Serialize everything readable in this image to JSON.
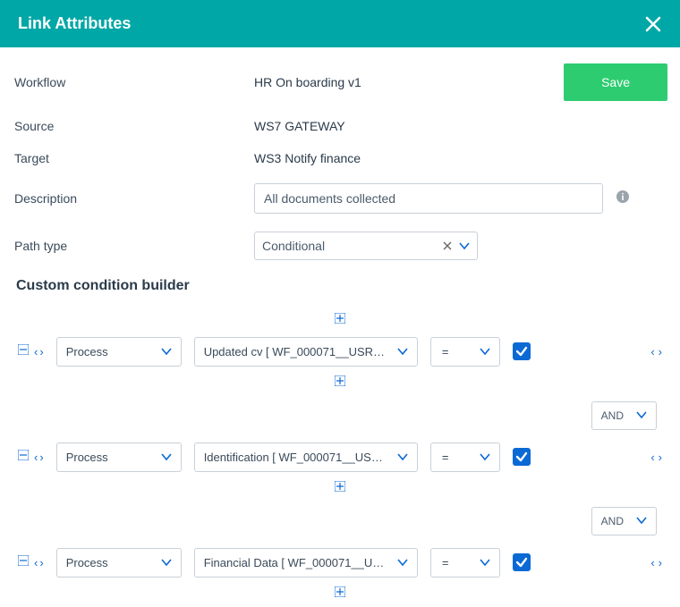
{
  "header": {
    "title": "Link Attributes"
  },
  "labels": {
    "workflow": "Workflow",
    "source": "Source",
    "target": "Target",
    "description": "Description",
    "path_type": "Path type",
    "save": "Save"
  },
  "values": {
    "workflow": "HR On boarding v1",
    "source": "WS7 GATEWAY",
    "target": "WS3 Notify finance",
    "description": "All documents collected",
    "path_type": "Conditional"
  },
  "builder": {
    "title": "Custom condition builder",
    "connector": "AND",
    "rows": [
      {
        "scope": "Process",
        "field": "Updated cv [ WF_000071__USR_U...",
        "operator": "=",
        "checked": true
      },
      {
        "scope": "Process",
        "field": "Identification [ WF_000071__USR_...",
        "operator": "=",
        "checked": true
      },
      {
        "scope": "Process",
        "field": "Financial Data [ WF_000071__USR...",
        "operator": "=",
        "checked": true
      }
    ]
  }
}
